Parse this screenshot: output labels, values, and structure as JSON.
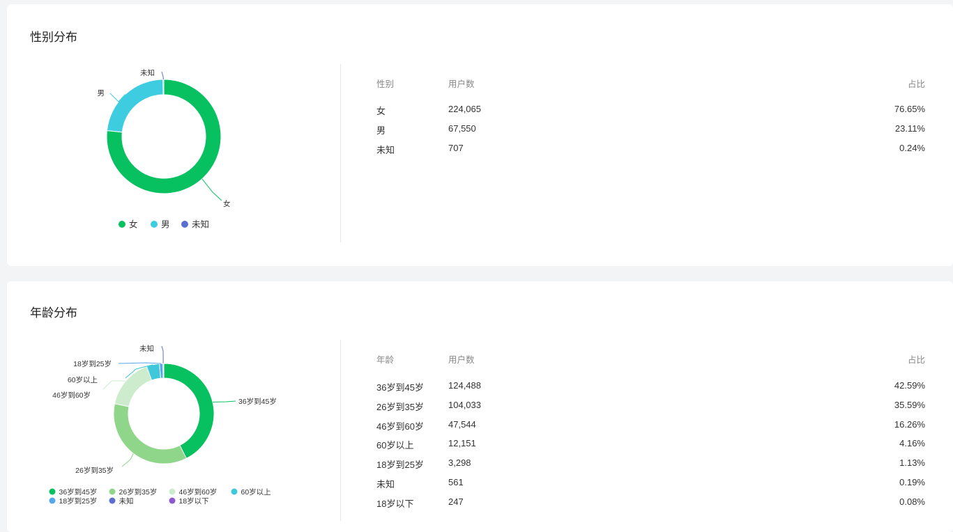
{
  "gender_section": {
    "title": "性别分布",
    "table": {
      "headers": [
        "性别",
        "用户数",
        "占比"
      ],
      "rows": [
        {
          "label": "女",
          "count": "224,065",
          "pct": "76.65%"
        },
        {
          "label": "男",
          "count": "67,550",
          "pct": "23.11%"
        },
        {
          "label": "未知",
          "count": "707",
          "pct": "0.24%"
        }
      ]
    }
  },
  "age_section": {
    "title": "年龄分布",
    "table": {
      "headers": [
        "年龄",
        "用户数",
        "占比"
      ],
      "rows": [
        {
          "label": "36岁到45岁",
          "count": "124,488",
          "pct": "42.59%"
        },
        {
          "label": "26岁到35岁",
          "count": "104,033",
          "pct": "35.59%"
        },
        {
          "label": "46岁到60岁",
          "count": "47,544",
          "pct": "16.26%"
        },
        {
          "label": "60岁以上",
          "count": "12,151",
          "pct": "4.16%"
        },
        {
          "label": "18岁到25岁",
          "count": "3,298",
          "pct": "1.13%"
        },
        {
          "label": "未知",
          "count": "561",
          "pct": "0.19%"
        },
        {
          "label": "18岁以下",
          "count": "247",
          "pct": "0.08%"
        }
      ]
    }
  },
  "chart_data": [
    {
      "type": "pie",
      "variant": "donut",
      "title": "性别分布",
      "categories": [
        "女",
        "男",
        "未知"
      ],
      "values": [
        224065,
        67550,
        707
      ],
      "colors": [
        "#07c160",
        "#3ecde0",
        "#5b6fd1"
      ],
      "legend_position": "bottom",
      "slice_labels": [
        "女",
        "男",
        "未知"
      ]
    },
    {
      "type": "pie",
      "variant": "donut",
      "title": "年龄分布",
      "categories": [
        "36岁到45岁",
        "26岁到35岁",
        "46岁到60岁",
        "60岁以上",
        "18岁到25岁",
        "未知",
        "18岁以下"
      ],
      "values": [
        124488,
        104033,
        47544,
        12151,
        3298,
        561,
        247
      ],
      "colors": [
        "#07c160",
        "#8fd68a",
        "#cdeccd",
        "#3ec8da",
        "#55a7ee",
        "#5b6fd1",
        "#8c59cf"
      ],
      "legend_position": "bottom",
      "slice_labels": [
        "36岁到45岁",
        "26岁到35岁",
        "46岁到60岁",
        "60岁以上",
        "18岁到25岁",
        "未知"
      ]
    }
  ]
}
